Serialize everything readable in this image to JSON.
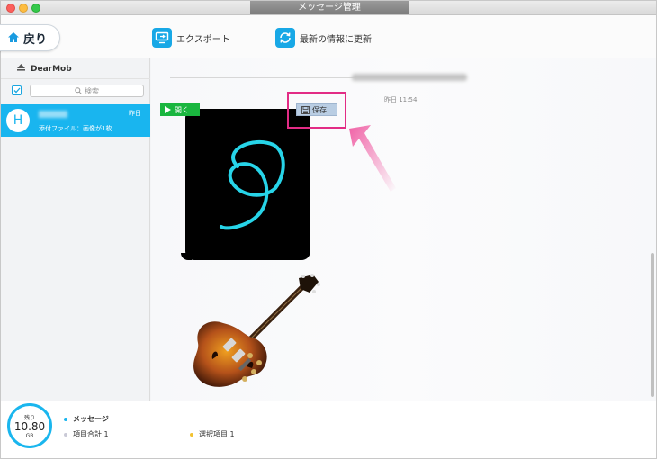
{
  "window": {
    "title": "メッセージ管理"
  },
  "toolbar": {
    "back_label": "戻り",
    "export_label": "エクスポート",
    "refresh_label": "最新の情報に更新"
  },
  "sidebar": {
    "device_name": "DearMob",
    "search_placeholder": "検索",
    "conversations": [
      {
        "avatar_letter": "H",
        "date": "昨日",
        "snippet": "添付ファイル：画像が1枚"
      }
    ]
  },
  "main": {
    "timestamp": "昨日 11:54",
    "open_label": "開く",
    "save_label": "保存"
  },
  "footer": {
    "storage_label_top": "残り",
    "storage_value": "10.80",
    "storage_unit": "GB",
    "legend_messages": "メッセージ",
    "legend_total": "項目合計 1",
    "legend_selected": "選択項目 1"
  },
  "colors": {
    "accent": "#19b5ef",
    "open_green": "#1ab63f",
    "highlight": "#e22c85",
    "drawing_cyan": "#27d4e8"
  }
}
